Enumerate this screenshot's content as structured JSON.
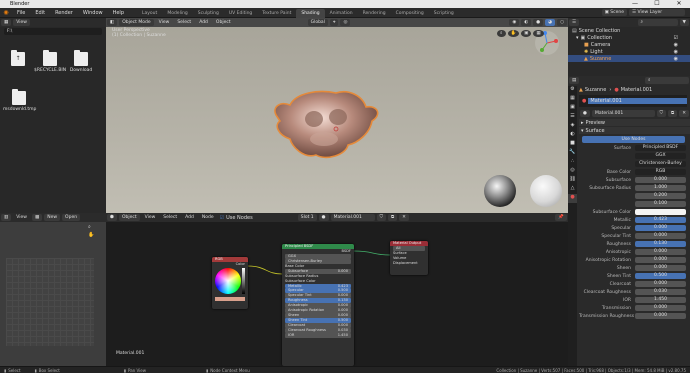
{
  "window": {
    "title": "Blender",
    "controls": [
      "—",
      "☐",
      "✕"
    ]
  },
  "menu": [
    "File",
    "Edit",
    "Render",
    "Window",
    "Help"
  ],
  "workspaces": [
    "Layout",
    "Modeling",
    "Sculpting",
    "UV Editing",
    "Texture Paint",
    "Shading",
    "Animation",
    "Rendering",
    "Compositing",
    "Scripting"
  ],
  "scene": {
    "label": "Scene",
    "layer": "View Layer"
  },
  "filebrowser": {
    "view": "View",
    "path": "F:\\",
    "items": [
      {
        "label": ""
      },
      {
        "label": "$RECYCLE.BIN"
      },
      {
        "label": "Download"
      },
      {
        "label": "msdownld.tmp"
      }
    ]
  },
  "viewport": {
    "mode": "Object Mode",
    "menus": [
      "View",
      "Select",
      "Add",
      "Object"
    ],
    "orientation": "Global",
    "overlay_line1": "User Perspective",
    "overlay_line2": "(1) Collection | Suzanne"
  },
  "outliner": {
    "items": [
      {
        "label": "Scene Collection"
      },
      {
        "label": "Collection"
      },
      {
        "label": "Camera"
      },
      {
        "label": "Light"
      },
      {
        "label": "Suzanne"
      }
    ]
  },
  "properties": {
    "object": "Suzanne",
    "material_tab": "Material.001",
    "slot": "Material.001",
    "material_name": "Material.001",
    "preview_label": "Preview",
    "surface_label": "Surface",
    "use_nodes": "Use Nodes",
    "rows": [
      {
        "label": "Surface",
        "value": "Principled BSDF",
        "style": "dark"
      },
      {
        "label": "",
        "value": "GGX",
        "style": "dark"
      },
      {
        "label": "",
        "value": "Christensen-Burley",
        "style": "dark"
      },
      {
        "label": "Base Color",
        "value": "RGB",
        "style": "dark"
      },
      {
        "label": "Subsurface",
        "value": "0.000",
        "style": ""
      },
      {
        "label": "Subsurface Radius",
        "value": "1.000",
        "style": ""
      },
      {
        "label": "",
        "value": "0.200",
        "style": ""
      },
      {
        "label": "",
        "value": "0.100",
        "style": ""
      },
      {
        "label": "Subsurface Color",
        "value": "",
        "style": "white"
      },
      {
        "label": "Metallic",
        "value": "0.423",
        "style": "blue"
      },
      {
        "label": "Specular",
        "value": "0.000",
        "style": "blue"
      },
      {
        "label": "Specular Tint",
        "value": "0.000",
        "style": ""
      },
      {
        "label": "Roughness",
        "value": "0.130",
        "style": "blue"
      },
      {
        "label": "Anisotropic",
        "value": "0.000",
        "style": ""
      },
      {
        "label": "Anisotropic Rotation",
        "value": "0.000",
        "style": ""
      },
      {
        "label": "Sheen",
        "value": "0.000",
        "style": ""
      },
      {
        "label": "Sheen Tint",
        "value": "0.500",
        "style": "blue"
      },
      {
        "label": "Clearcoat",
        "value": "0.000",
        "style": ""
      },
      {
        "label": "Clearcoat Roughness",
        "value": "0.030",
        "style": ""
      },
      {
        "label": "IOR",
        "value": "1.450",
        "style": ""
      },
      {
        "label": "Transmission",
        "value": "0.000",
        "style": ""
      },
      {
        "label": "Transmission Roughness",
        "value": "0.000",
        "style": ""
      }
    ]
  },
  "uv": {
    "menus": [
      "View"
    ],
    "new": "New",
    "open": "Open"
  },
  "nodeeditor": {
    "type": "Object",
    "menus": [
      "View",
      "Select",
      "Add",
      "Node"
    ],
    "use_nodes": "Use Nodes",
    "slot": "Slot 1",
    "material": "Material.001",
    "footer": "Material.001",
    "rgb_node": {
      "title": "RGB",
      "out": "Color"
    },
    "bsdf_node": {
      "title": "Principled BSDF",
      "out": "BSDF",
      "rows": [
        "GGX",
        "Christensen-Burley",
        "Base Color",
        "Subsurface",
        "Subsurface Radius",
        "Subsurface Color",
        "Metallic",
        "Specular",
        "Specular Tint",
        "Roughness",
        "Anisotropic",
        "Anisotropic Rotation",
        "Sheen",
        "Sheen Tint",
        "Clearcoat",
        "Clearcoat Roughness",
        "IOR"
      ],
      "vals": [
        "",
        "",
        "",
        "0.000",
        "",
        "",
        "0.423",
        "0.500",
        "0.000",
        "0.130",
        "0.000",
        "0.000",
        "0.000",
        "0.500",
        "0.000",
        "0.030",
        "1.450"
      ]
    },
    "output_node": {
      "title": "Material Output",
      "target": "All",
      "rows": [
        "Surface",
        "Volume",
        "Displacement"
      ]
    }
  },
  "statusbar": {
    "select": "Select",
    "box": "Box Select",
    "pan": "Pan View",
    "ctx": "Node Context Menu",
    "info": "Collection | Suzanne | Verts:507 | Faces:500 | Tris:968 | Objects:1/3 | Mem: 54.8 MiB | v2.80.75"
  },
  "colors": {
    "accent": "#4772b3",
    "selection": "#e58a3a",
    "node_rgb": "#a33a3a",
    "node_bsdf": "#2f8a4a",
    "node_output": "#9a2d36"
  }
}
